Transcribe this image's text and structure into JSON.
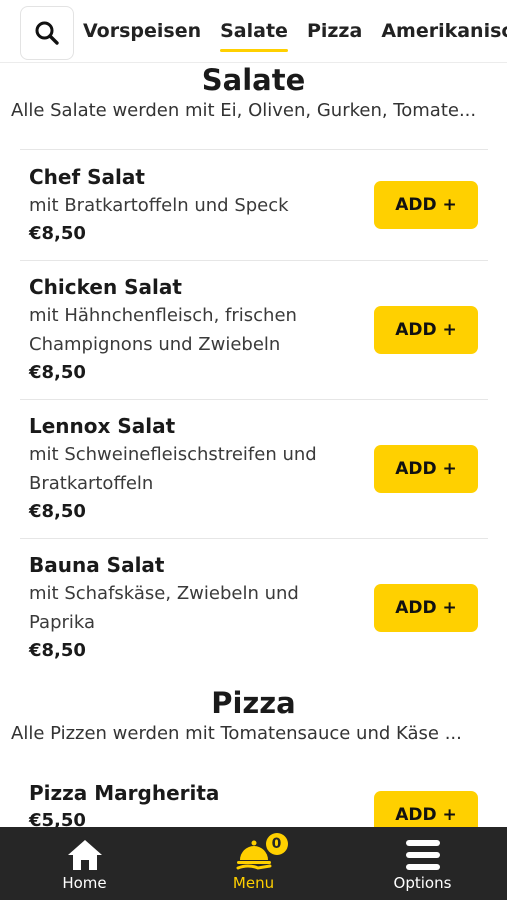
{
  "colors": {
    "accent": "#ffd000",
    "nav_bg": "#262626"
  },
  "search": {
    "icon": "search-icon"
  },
  "tabs": [
    "Vorspeisen",
    "Salate",
    "Pizza",
    "Amerikanische"
  ],
  "active_tab": "Salate",
  "sections": [
    {
      "title": "Salate",
      "description": "Alle Salate werden mit Ei, Oliven, Gurken, Tomate...",
      "items": [
        {
          "name": "Chef Salat",
          "description": "mit Bratkartoffeln und Speck",
          "price": "€8,50",
          "button": "ADD +"
        },
        {
          "name": "Chicken Salat",
          "description": "mit Hähnchenfleisch, frischen Champignons und Zwiebeln",
          "price": "€8,50",
          "button": "ADD +"
        },
        {
          "name": "Lennox Salat",
          "description": "mit Schweinefleischstreifen und Bratkartoffeln",
          "price": "€8,50",
          "button": "ADD +"
        },
        {
          "name": "Bauna Salat",
          "description": "mit Schafskäse, Zwiebeln und Paprika",
          "price": "€8,50",
          "button": "ADD +"
        }
      ]
    },
    {
      "title": "Pizza",
      "description": "Alle Pizzen werden mit Tomatensauce und Käse ...",
      "items": [
        {
          "name": "Pizza Margherita",
          "description": "",
          "price": "€5,50",
          "button": "ADD +"
        }
      ]
    }
  ],
  "bottom_nav": {
    "items": [
      {
        "label": "Home",
        "icon": "home-icon"
      },
      {
        "label": "Menu",
        "icon": "cloche-icon",
        "badge": "0"
      },
      {
        "label": "Options",
        "icon": "menu-icon"
      }
    ]
  }
}
